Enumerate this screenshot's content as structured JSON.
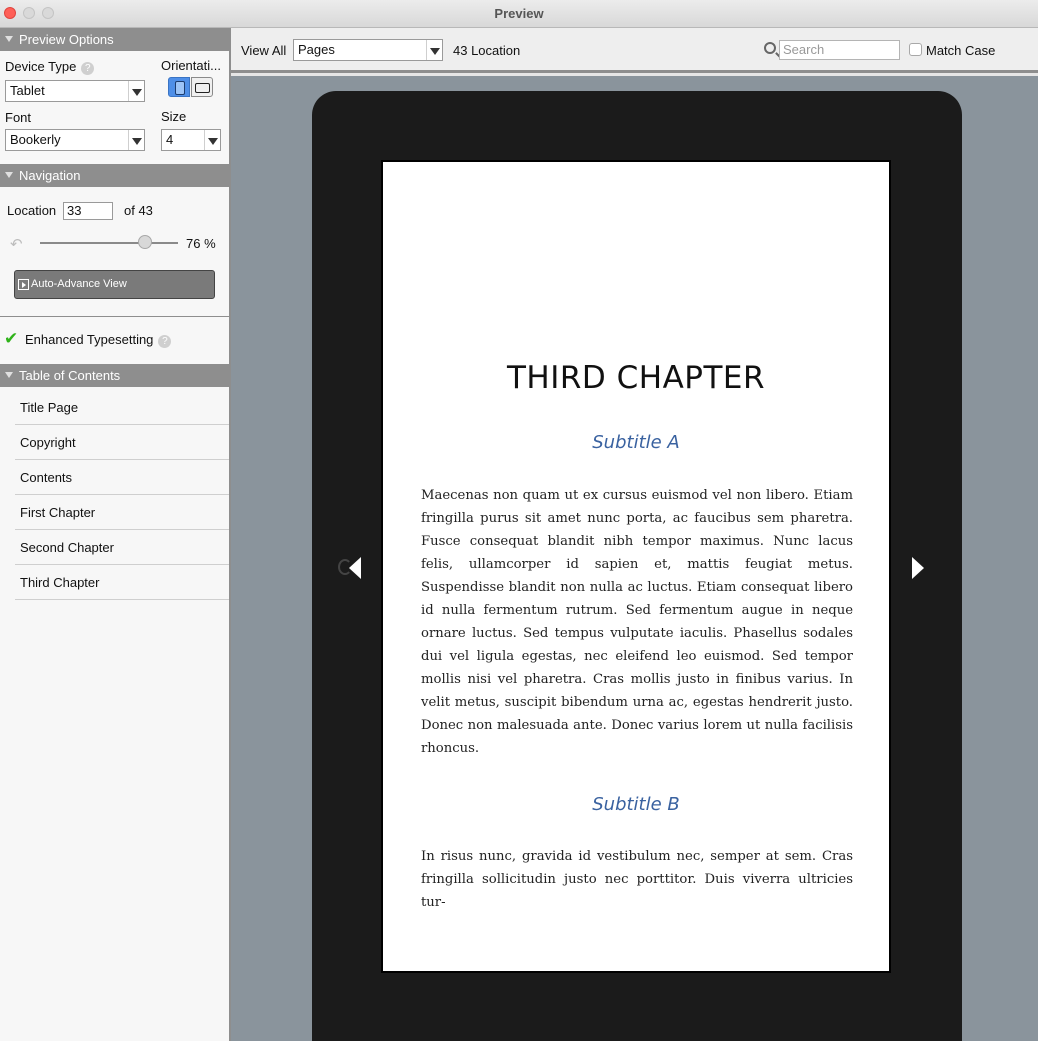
{
  "window": {
    "title": "Preview"
  },
  "sidebar": {
    "preview_options": {
      "header": "Preview Options",
      "device_type_label": "Device Type",
      "device_type_value": "Tablet",
      "orientation_label": "Orientati...",
      "orientation_selected": "portrait",
      "font_label": "Font",
      "font_value": "Bookerly",
      "size_label": "Size",
      "size_value": "4"
    },
    "navigation": {
      "header": "Navigation",
      "location_label": "Location",
      "location_value": "33",
      "of_label": "of 43",
      "progress": 0.76,
      "percent_label": "76 %",
      "auto_advance_label": "Auto-Advance View"
    },
    "enhanced_typesetting": {
      "label": "Enhanced Typesetting",
      "checked": true
    },
    "toc": {
      "header": "Table of Contents",
      "items": [
        {
          "label": "Title Page"
        },
        {
          "label": "Copyright"
        },
        {
          "label": "Contents"
        },
        {
          "label": "First Chapter"
        },
        {
          "label": "Second Chapter"
        },
        {
          "label": "Third Chapter"
        }
      ]
    }
  },
  "toolbar": {
    "view_all_label": "View All",
    "view_mode_value": "Pages",
    "location_count": "43 Location",
    "search_placeholder": "Search",
    "match_case_label": "Match Case",
    "match_case_checked": false
  },
  "page": {
    "chapter_title": "THIRD CHAPTER",
    "subtitle_a": "Subtitle A",
    "paragraph_a": "Maecenas non quam ut ex cursus euismod vel non libero. Etiam fringilla purus sit amet nunc porta, ac faucibus sem pharetra. Fusce consequat blandit nibh tempor maximus. Nunc lacus felis, ullamcorper id sapien et, mattis feugiat metus. Suspendisse blandit non nulla ac luctus. Etiam consequat libero id nulla fermentum rutrum. Sed fermentum augue in neque ornare luctus. Sed tempus vulputate iaculis. Phasellus sodales dui vel ligula egestas, nec eleifend leo euismod. Sed tempor mollis nisi vel pharetra. Cras mollis justo in finibus varius. In velit metus, suscipit bibendum urna ac, egestas hendrerit justo. Donec non malesuada ante. Donec varius lorem ut nulla facilisis rhoncus.",
    "subtitle_b": "Subtitle B",
    "paragraph_b": "In risus nunc, gravida id vestibulum nec, semper at sem. Cras fringilla sollicitudin justo nec porttitor. Duis viverra ultricies tur-"
  },
  "colors": {
    "accent_blue": "#4e8fe8",
    "subtitle_blue": "#3a62a0",
    "header_gray": "#8e8e8e",
    "check_green": "#2fb31a"
  }
}
